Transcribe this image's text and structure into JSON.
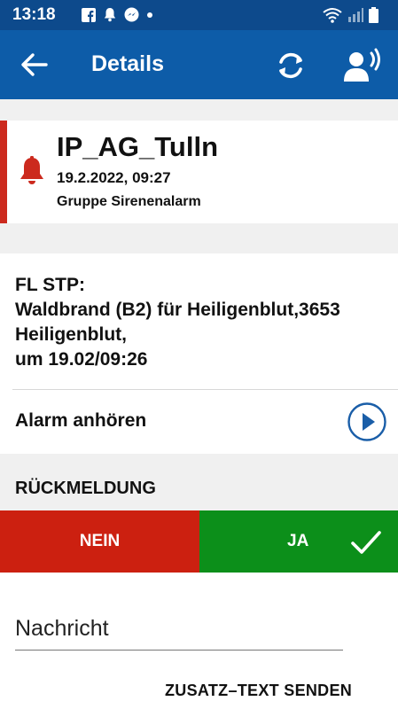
{
  "status_bar": {
    "time": "13:18",
    "left_icons": [
      "facebook-icon",
      "notification-bell-icon",
      "messenger-icon",
      "dot-icon"
    ],
    "right_icons": [
      "wifi-icon",
      "signal-icon",
      "battery-icon"
    ]
  },
  "app_bar": {
    "title": "Details",
    "background": "#0d5ca8"
  },
  "alarm": {
    "name": "IP_AG_Tulln",
    "datetime": "19.2.2022, 09:27",
    "group": "Gruppe Sirenenalarm",
    "accent": "#cc2a1e"
  },
  "message_lines": [
    "FL STP:",
    "Waldbrand (B2) für Heiligenblut,3653",
    "Heiligenblut,",
    "um 19.02/09:26"
  ],
  "listen": {
    "label": "Alarm anhören"
  },
  "feedback": {
    "heading": "RÜCKMELDUNG",
    "no_label": "NEIN",
    "yes_label": "JA",
    "no_color": "#cc2010",
    "yes_color": "#0c8f1a"
  },
  "message_input": {
    "placeholder": "Nachricht"
  },
  "send_label": "ZUSATZ–TEXT SENDEN"
}
